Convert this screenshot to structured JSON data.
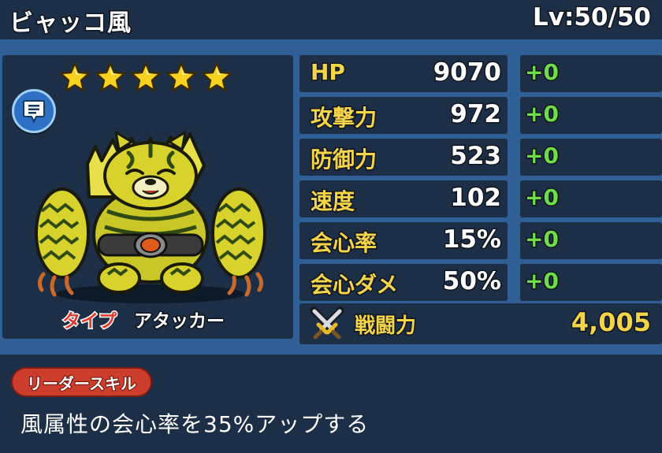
{
  "header": {
    "name": "ビャッコ風",
    "level": "Lv:50/50"
  },
  "character": {
    "stars": 5,
    "type_label": "タイプ",
    "type_value": "アタッカー",
    "monster_icon": "white-tiger-monster",
    "chat_icon": "chat-bubble-icon"
  },
  "stats": [
    {
      "name": "HP",
      "value": "9070",
      "bonus": "+0"
    },
    {
      "name": "攻撃力",
      "value": "972",
      "bonus": "+0"
    },
    {
      "name": "防御力",
      "value": "523",
      "bonus": "+0"
    },
    {
      "name": "速度",
      "value": "102",
      "bonus": "+0"
    },
    {
      "name": "会心率",
      "value": "15%",
      "bonus": "+0"
    },
    {
      "name": "会心ダメ",
      "value": "50%",
      "bonus": "+0"
    }
  ],
  "power": {
    "label": "戦闘力",
    "value": "4,005",
    "icon": "crossed-swords-icon"
  },
  "leader_skill": {
    "label": "リーダースキル",
    "description": "風属性の会心率を35%アップする"
  },
  "colors": {
    "background": "#2f5f95",
    "panel": "#1c2f47",
    "stat_label": "#f4d54a",
    "bonus": "#6fdc4a",
    "type_label": "#e23a2d",
    "skill_pill": "#cc3d2c"
  }
}
